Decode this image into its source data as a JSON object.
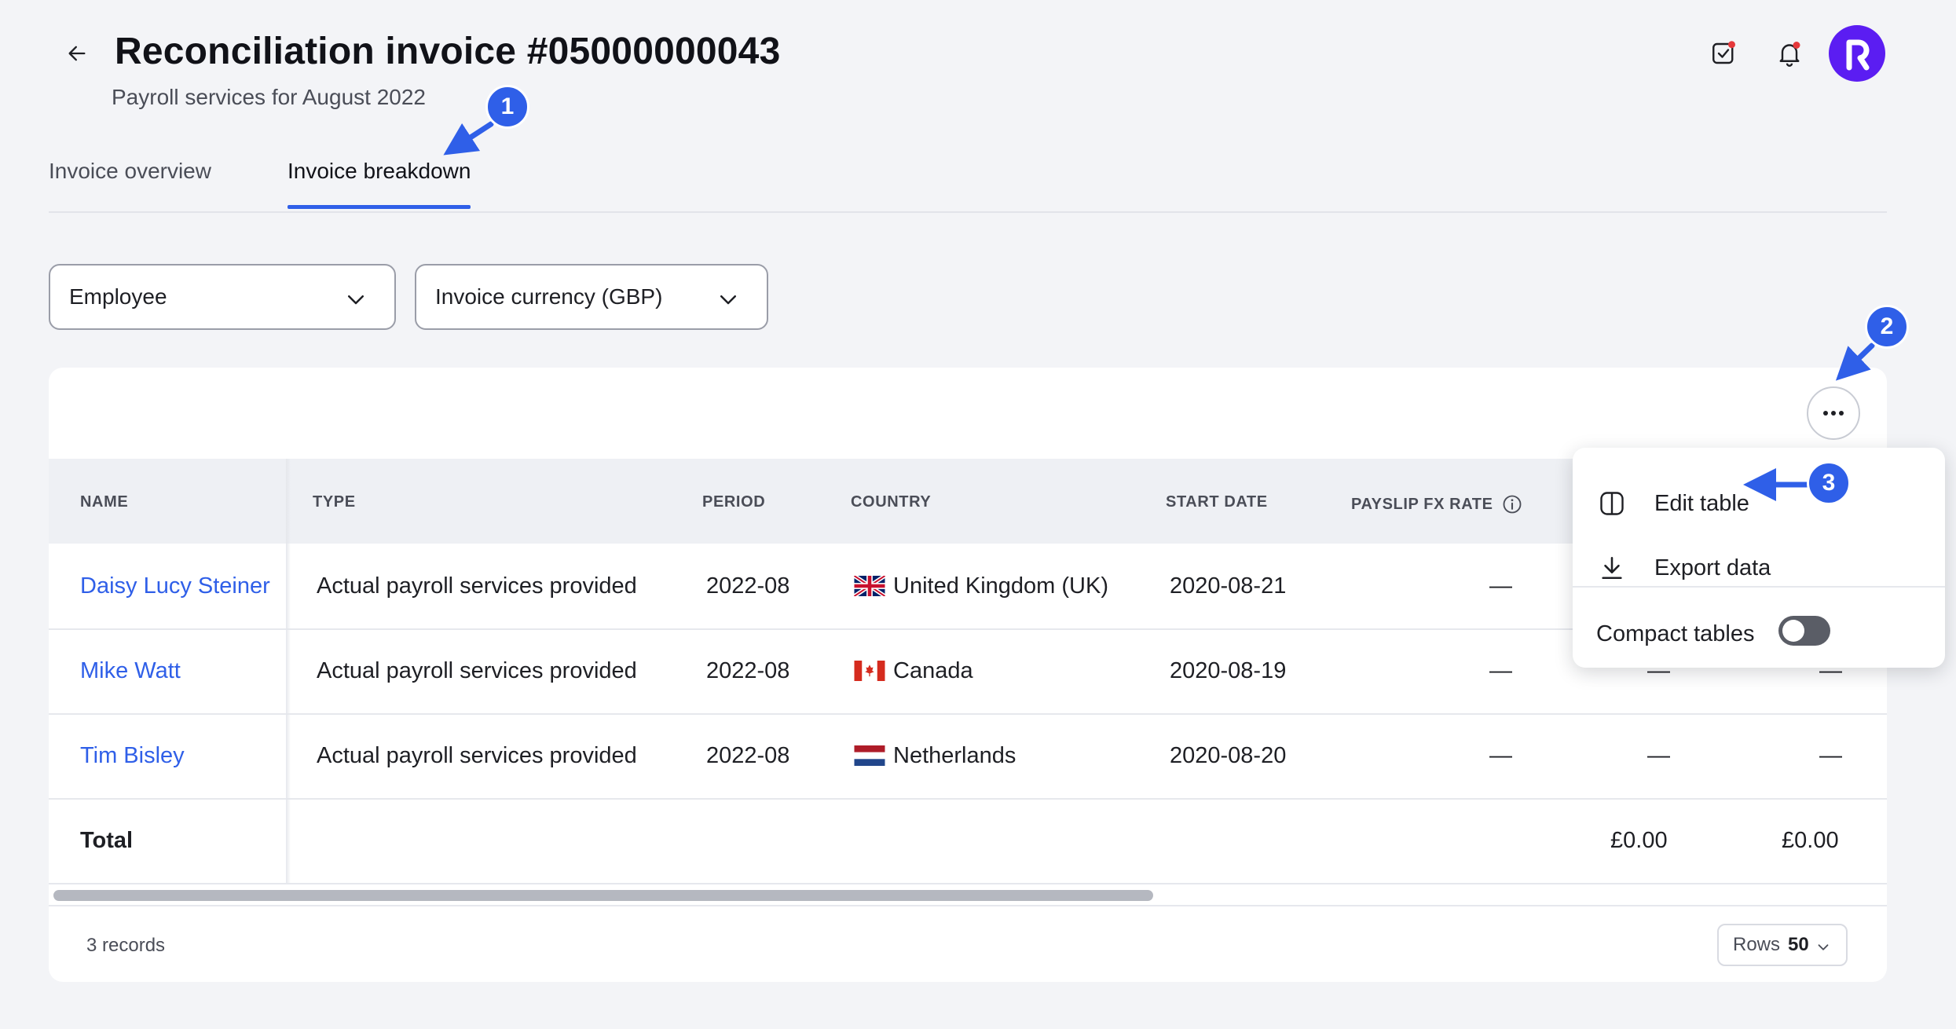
{
  "header": {
    "title": "Reconciliation invoice #05000000043",
    "subtitle": "Payroll services for August 2022",
    "avatar_letter": "R"
  },
  "tabs": [
    {
      "label": "Invoice overview",
      "active": false
    },
    {
      "label": "Invoice breakdown",
      "active": true
    }
  ],
  "filters": {
    "group_by": "Employee",
    "currency": "Invoice currency (GBP)"
  },
  "table": {
    "columns": [
      "NAME",
      "TYPE",
      "PERIOD",
      "COUNTRY",
      "START DATE",
      "PAYSLIP FX RATE"
    ],
    "rows": [
      {
        "name": "Daisy Lucy Steiner",
        "type": "Actual payroll services provided",
        "period": "2022-08",
        "country": "United Kingdom (UK)",
        "start_date": "2020-08-21",
        "fx": "—",
        "c7": "—",
        "c8": "—"
      },
      {
        "name": "Mike Watt",
        "type": "Actual payroll services provided",
        "period": "2022-08",
        "country": "Canada",
        "start_date": "2020-08-19",
        "fx": "—",
        "c7": "—",
        "c8": "—"
      },
      {
        "name": "Tim Bisley",
        "type": "Actual payroll services provided",
        "period": "2022-08",
        "country": "Netherlands",
        "start_date": "2020-08-20",
        "fx": "—",
        "c7": "—",
        "c8": "—"
      }
    ],
    "total_label": "Total",
    "total_c7": "£0.00",
    "total_c8": "£0.00"
  },
  "footer": {
    "records": "3 records",
    "rows_label": "Rows",
    "rows_value": "50"
  },
  "menu": {
    "edit_table": "Edit table",
    "export_data": "Export data",
    "compact_tables": "Compact tables",
    "compact_on": false
  },
  "annotations": [
    "1",
    "2",
    "3"
  ],
  "colors": {
    "accent": "#2f5fe8",
    "avatar": "#5b1df2",
    "notification_dot": "#e5383b"
  }
}
